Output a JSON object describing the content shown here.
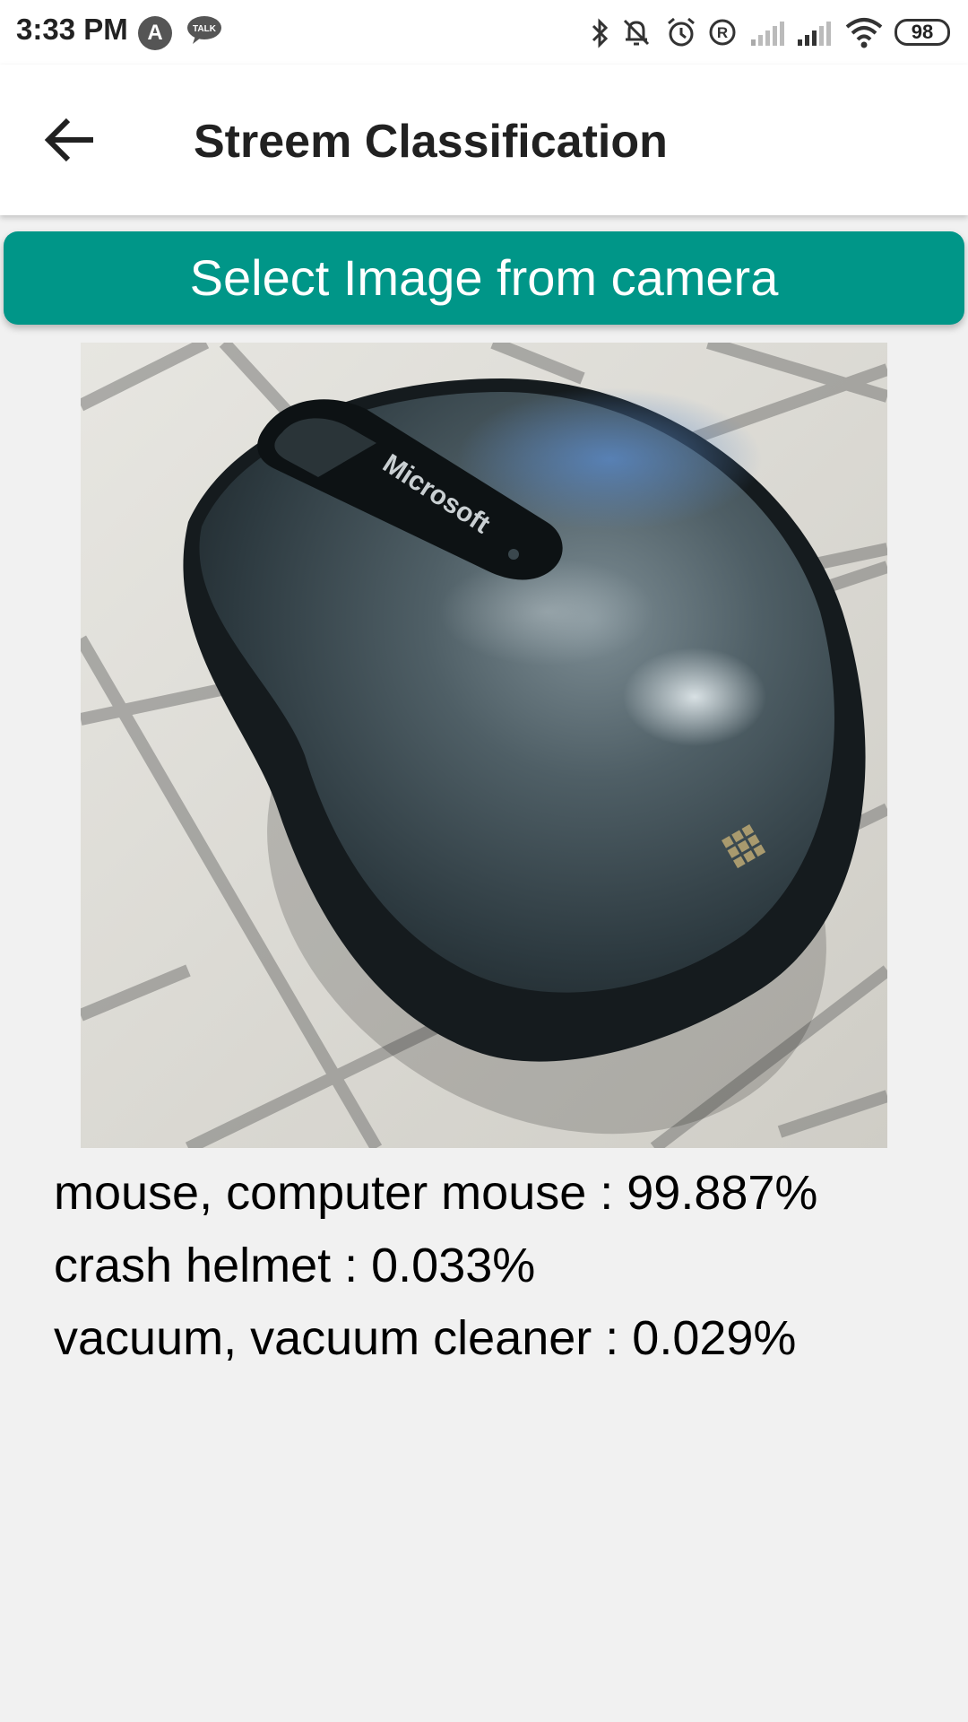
{
  "status_bar": {
    "time": "3:33 PM",
    "notification_icons": [
      "app-a-icon",
      "talk-icon"
    ],
    "notification_a_letter": "A",
    "talk_label": "TALK",
    "system_icons": [
      "bluetooth-icon",
      "vibrate-off-icon",
      "alarm-icon",
      "registered-icon",
      "signal-weak-icon",
      "signal-icon",
      "wifi-icon",
      "battery-icon"
    ],
    "battery_level": "98"
  },
  "app_bar": {
    "back_icon": "arrow-left-icon",
    "title": "Streem Classification"
  },
  "main": {
    "select_button_label": "Select Image from camera",
    "photo_subject": "computer-mouse-photo",
    "photo_brand_text": "Microsoft",
    "accent_color": "#009688",
    "results": [
      "mouse, computer mouse : 99.887%",
      "crash helmet : 0.033%",
      "vacuum, vacuum cleaner : 0.029%"
    ]
  }
}
